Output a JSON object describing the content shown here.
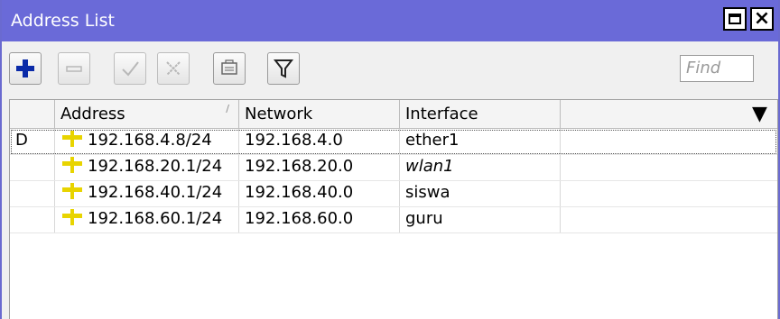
{
  "window": {
    "title": "Address List"
  },
  "toolbar": {
    "find_placeholder": "Find",
    "buttons": [
      {
        "name": "add-button",
        "icon": "plus-icon",
        "enabled": true
      },
      {
        "name": "remove-button",
        "icon": "minus-icon",
        "enabled": false
      },
      {
        "name": "enable-button",
        "icon": "check-icon",
        "enabled": false
      },
      {
        "name": "disable-button",
        "icon": "cross-icon",
        "enabled": false
      },
      {
        "name": "comment-button",
        "icon": "comment-icon",
        "enabled": true
      },
      {
        "name": "filter-button",
        "icon": "filter-icon",
        "enabled": true
      }
    ]
  },
  "table": {
    "columns": [
      "",
      "Address",
      "Network",
      "Interface",
      ""
    ],
    "rows": [
      {
        "flag": "D",
        "address": "192.168.4.8/24",
        "network": "192.168.4.0",
        "interface": "ether1",
        "interface_italic": false,
        "selected": true
      },
      {
        "flag": "",
        "address": "192.168.20.1/24",
        "network": "192.168.20.0",
        "interface": "wlan1",
        "interface_italic": true,
        "selected": false
      },
      {
        "flag": "",
        "address": "192.168.40.1/24",
        "network": "192.168.40.0",
        "interface": "siswa",
        "interface_italic": false,
        "selected": false
      },
      {
        "flag": "",
        "address": "192.168.60.1/24",
        "network": "192.168.60.0",
        "interface": "guru",
        "interface_italic": false,
        "selected": false
      }
    ]
  },
  "colors": {
    "titlebar": "#6a6ad8",
    "address_icon": "#e8d400",
    "add_icon": "#0a2aa8"
  }
}
